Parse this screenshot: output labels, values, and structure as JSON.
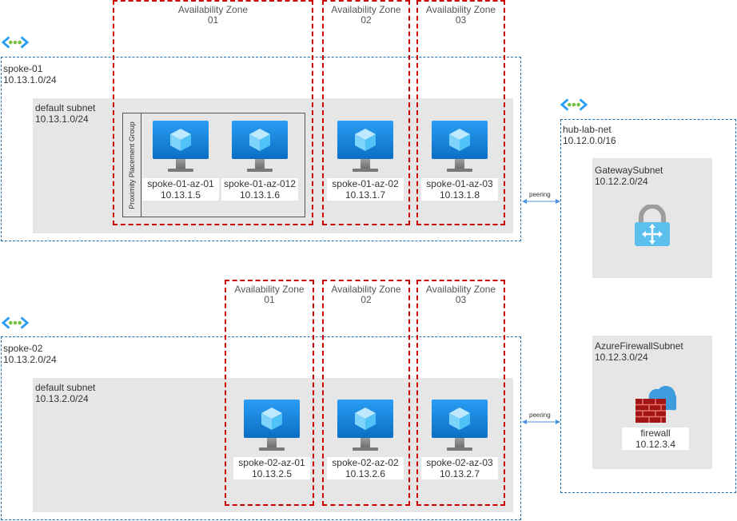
{
  "spoke01": {
    "name": "spoke-01",
    "cidr": "10.13.1.0/24",
    "subnet": {
      "name": "default subnet",
      "cidr": "10.13.1.0/24"
    },
    "ppg_label": "Proximity Placement Group",
    "zones": [
      {
        "line1": "Availability Zone",
        "line2": "01"
      },
      {
        "line1": "Availability Zone",
        "line2": "02"
      },
      {
        "line1": "Availability Zone",
        "line2": "03"
      }
    ],
    "vms": [
      {
        "name": "spoke-01-az-01",
        "ip": "10.13.1.5"
      },
      {
        "name": "spoke-01-az-012",
        "ip": "10.13.1.6"
      },
      {
        "name": "spoke-01-az-02",
        "ip": "10.13.1.7"
      },
      {
        "name": "spoke-01-az-03",
        "ip": "10.13.1.8"
      }
    ]
  },
  "spoke02": {
    "name": "spoke-02",
    "cidr": "10.13.2.0/24",
    "subnet": {
      "name": "default subnet",
      "cidr": "10.13.2.0/24"
    },
    "zones": [
      {
        "line1": "Availability Zone",
        "line2": "01"
      },
      {
        "line1": "Availability Zone",
        "line2": "02"
      },
      {
        "line1": "Availability Zone",
        "line2": "03"
      }
    ],
    "vms": [
      {
        "name": "spoke-02-az-01",
        "ip": "10.13.2.5"
      },
      {
        "name": "spoke-02-az-02",
        "ip": "10.13.2.6"
      },
      {
        "name": "spoke-02-az-03",
        "ip": "10.13.2.7"
      }
    ]
  },
  "hub": {
    "name": "hub-lab-net",
    "cidr": "10.12.0.0/16",
    "gateway_subnet": {
      "name": "GatewaySubnet",
      "cidr": "10.12.2.0/24"
    },
    "firewall_subnet": {
      "name": "AzureFirewallSubnet",
      "cidr": "10.12.3.0/24"
    },
    "firewall": {
      "name": "firewall",
      "ip": "10.12.3.4"
    }
  },
  "peerings": [
    "peering",
    "peering"
  ],
  "colors": {
    "vnet_border": "#1f6fb2",
    "az_border": "#cc0000",
    "subnet_fill": "#e6e6e6",
    "vm_blue": "#1e88e5"
  },
  "icons": [
    "vnet-icon",
    "vm-icon",
    "vpn-gateway-icon",
    "firewall-icon"
  ]
}
